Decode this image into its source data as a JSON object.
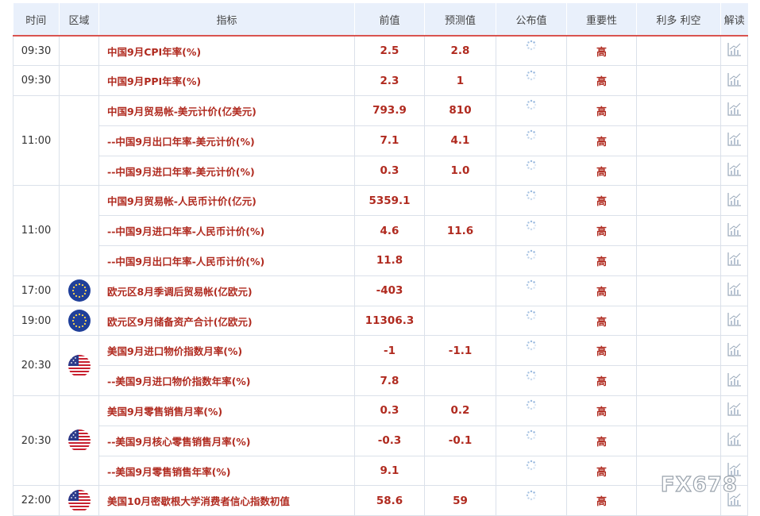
{
  "columns": [
    "时间",
    "区域",
    "指标",
    "前值",
    "预测值",
    "公布值",
    "重要性",
    "利多 利空",
    "解读"
  ],
  "groups": [
    {
      "time": "09:30",
      "region": "",
      "rows": [
        {
          "indicator": "中国9月CPI年率(%)",
          "prev": "2.5",
          "forecast": "2.8",
          "actual": "",
          "importance": "高",
          "impact": ""
        }
      ]
    },
    {
      "time": "09:30",
      "region": "",
      "rows": [
        {
          "indicator": "中国9月PPI年率(%)",
          "prev": "2.3",
          "forecast": "1",
          "actual": "",
          "importance": "高",
          "impact": ""
        }
      ]
    },
    {
      "time": "11:00",
      "region": "",
      "rows": [
        {
          "indicator": "中国9月贸易帐-美元计价(亿美元)",
          "prev": "793.9",
          "forecast": "810",
          "actual": "",
          "importance": "高",
          "impact": ""
        },
        {
          "indicator": "--中国9月出口年率-美元计价(%)",
          "prev": "7.1",
          "forecast": "4.1",
          "actual": "",
          "importance": "高",
          "impact": ""
        },
        {
          "indicator": "--中国9月进口年率-美元计价(%)",
          "prev": "0.3",
          "forecast": "1.0",
          "actual": "",
          "importance": "高",
          "impact": ""
        }
      ]
    },
    {
      "time": "11:00",
      "region": "",
      "rows": [
        {
          "indicator": "中国9月贸易帐-人民币计价(亿元)",
          "prev": "5359.1",
          "forecast": "",
          "actual": "",
          "importance": "高",
          "impact": ""
        },
        {
          "indicator": "--中国9月进口年率-人民币计价(%)",
          "prev": "4.6",
          "forecast": "11.6",
          "actual": "",
          "importance": "高",
          "impact": ""
        },
        {
          "indicator": "--中国9月出口年率-人民币计价(%)",
          "prev": "11.8",
          "forecast": "",
          "actual": "",
          "importance": "高",
          "impact": ""
        }
      ]
    },
    {
      "time": "17:00",
      "region": "eu-flag",
      "rows": [
        {
          "indicator": "欧元区8月季调后贸易帐(亿欧元)",
          "prev": "-403",
          "forecast": "",
          "actual": "",
          "importance": "高",
          "impact": ""
        }
      ]
    },
    {
      "time": "19:00",
      "region": "eu-flag",
      "rows": [
        {
          "indicator": "欧元区9月储备资产合计(亿欧元)",
          "prev": "11306.3",
          "forecast": "",
          "actual": "",
          "importance": "高",
          "impact": ""
        }
      ]
    },
    {
      "time": "20:30",
      "region": "us-flag",
      "rows": [
        {
          "indicator": "美国9月进口物价指数月率(%)",
          "prev": "-1",
          "forecast": "-1.1",
          "actual": "",
          "importance": "高",
          "impact": ""
        },
        {
          "indicator": "--美国9月进口物价指数年率(%)",
          "prev": "7.8",
          "forecast": "",
          "actual": "",
          "importance": "高",
          "impact": ""
        }
      ]
    },
    {
      "time": "20:30",
      "region": "us-flag",
      "rows": [
        {
          "indicator": "美国9月零售销售月率(%)",
          "prev": "0.3",
          "forecast": "0.2",
          "actual": "",
          "importance": "高",
          "impact": ""
        },
        {
          "indicator": "--美国9月核心零售销售月率(%)",
          "prev": "-0.3",
          "forecast": "-0.1",
          "actual": "",
          "importance": "高",
          "impact": ""
        },
        {
          "indicator": "--美国9月零售销售年率(%)",
          "prev": "9.1",
          "forecast": "",
          "actual": "",
          "importance": "高",
          "impact": ""
        }
      ]
    },
    {
      "time": "22:00",
      "region": "us-flag",
      "rows": [
        {
          "indicator": "美国10月密歇根大学消费者信心指数初值",
          "prev": "58.6",
          "forecast": "59",
          "actual": "",
          "importance": "高",
          "impact": ""
        }
      ]
    }
  ],
  "icons": {
    "actual": "loading-spinner-icon",
    "analysis": "chart-analysis-icon"
  },
  "watermark": "FX678",
  "colors": {
    "header_bg": "#e9f0fb",
    "header_border": "#d9534f",
    "value_red": "#b02a1f",
    "grid": "#dbe1ea"
  }
}
